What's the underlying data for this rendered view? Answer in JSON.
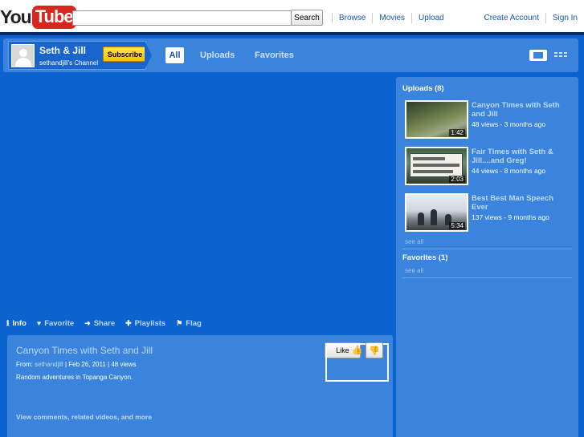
{
  "header": {
    "logo_you": "You",
    "logo_tube": "Tube",
    "search": {
      "value": "",
      "button_label": "Search"
    },
    "nav_main": [
      "Browse",
      "Movies",
      "Upload"
    ],
    "nav_right": [
      "Create Account",
      "Sign In"
    ]
  },
  "channel": {
    "name": "Seth & Jill",
    "subtitle": "sethandjill's Channel",
    "subscribe_label": "Subscribe",
    "tabs": [
      "All",
      "Uploads",
      "Favorites"
    ],
    "active_tab": "All"
  },
  "actions": {
    "info": "Info",
    "favorite": "Favorite",
    "share": "Share",
    "playlists": "Playlists",
    "flag": "Flag"
  },
  "video": {
    "title": "Canyon Times with Seth and Jill",
    "from_label": "From:",
    "author": "sethandjill",
    "date": "Feb 26, 2011",
    "views": "48 views",
    "description": "Random adventures in Topanga Canyon.",
    "like_label": "Like",
    "view_more": "View comments, related videos, and more"
  },
  "sidebar": {
    "uploads_title": "Uploads (8)",
    "uploads": [
      {
        "title": "Canyon Times with Seth and Jill",
        "stats": "48 views - 3 months ago",
        "duration": "1:42"
      },
      {
        "title": "Fair Times with Seth & Jill....and Greg!",
        "stats": "44 views - 8 months ago",
        "duration": "2:03"
      },
      {
        "title": "Best Best Man Speech Ever",
        "stats": "137 views - 9 months ago",
        "duration": "5:34"
      }
    ],
    "see_all": "see all",
    "favorites_title": "Favorites (1)",
    "favorites_see_all": "see all"
  },
  "colors": {
    "background": "#0b63cf",
    "panel": "#3a84de",
    "subscribe": "#f4c400",
    "logo_red": "#d8261f"
  },
  "icons": {
    "info": "info-icon",
    "favorite": "heart-icon",
    "share": "share-arrow-icon",
    "playlists": "plus-icon",
    "flag": "flag-icon",
    "like": "thumbs-up-icon",
    "dislike": "thumbs-down-icon"
  }
}
